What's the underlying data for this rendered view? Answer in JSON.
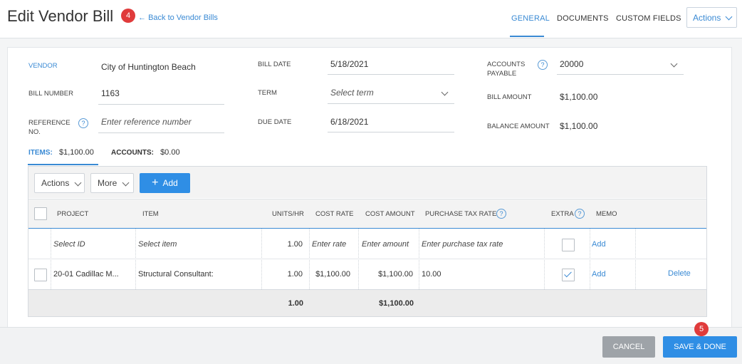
{
  "header": {
    "title": "Edit Vendor Bill",
    "step_badge_1": "4",
    "back_link": "Back to Vendor Bills",
    "tabs": [
      {
        "label": "GENERAL",
        "active": true
      },
      {
        "label": "DOCUMENTS",
        "active": false
      },
      {
        "label": "CUSTOM FIELDS",
        "active": false
      }
    ],
    "actions_label": "Actions"
  },
  "form": {
    "vendor_label": "VENDOR",
    "vendor_value": "City of Huntington Beach",
    "bill_number_label": "BILL NUMBER",
    "bill_number_value": "1163",
    "reference_label_1": "REFERENCE",
    "reference_label_2": "NO.",
    "reference_placeholder": "Enter reference number",
    "bill_date_label": "BILL DATE",
    "bill_date_value": "5/18/2021",
    "term_label": "TERM",
    "term_placeholder": "Select term",
    "due_date_label": "DUE DATE",
    "due_date_value": "6/18/2021",
    "accounts_payable_label_1": "ACCOUNTS",
    "accounts_payable_label_2": "PAYABLE",
    "accounts_payable_value": "20000",
    "bill_amount_label": "BILL AMOUNT",
    "bill_amount_value": "$1,100.00",
    "balance_amount_label": "BALANCE AMOUNT",
    "balance_amount_value": "$1,100.00",
    "help_glyph": "?"
  },
  "subtabs": {
    "items_label": "ITEMS:",
    "items_value": "$1,100.00",
    "accounts_label": "ACCOUNTS:",
    "accounts_value": "$0.00"
  },
  "toolbar": {
    "actions_label": "Actions",
    "more_label": "More",
    "add_label": "Add"
  },
  "table": {
    "columns": {
      "project": "PROJECT",
      "item": "ITEM",
      "units": "UNITS/HR",
      "cost_rate": "COST RATE",
      "cost_amount": "COST AMOUNT",
      "purchase_tax_rate": "PURCHASE TAX RATE",
      "extra": "EXTRA",
      "memo": "MEMO"
    },
    "new_row": {
      "project": "Select ID",
      "item": "Select item",
      "units": "1.00",
      "cost_rate": "Enter rate",
      "cost_amount": "Enter amount",
      "purchase_tax_rate": "Enter purchase tax rate",
      "extra_checked": false,
      "memo": "Add"
    },
    "rows": [
      {
        "project": "20-01 Cadillac M...",
        "item": "Structural Consultant:",
        "units": "1.00",
        "cost_rate": "$1,100.00",
        "cost_amount": "$1,100.00",
        "purchase_tax_rate": "10.00",
        "extra_checked": true,
        "memo": "Add",
        "delete": "Delete"
      }
    ],
    "totals": {
      "units": "1.00",
      "cost_amount": "$1,100.00"
    }
  },
  "footer": {
    "cancel_label": "CANCEL",
    "save_label": "SAVE & DONE",
    "step_badge_2": "5"
  },
  "colors": {
    "accent": "#2f8ee5",
    "link": "#3a8ad4",
    "badge": "#e03b3b"
  }
}
